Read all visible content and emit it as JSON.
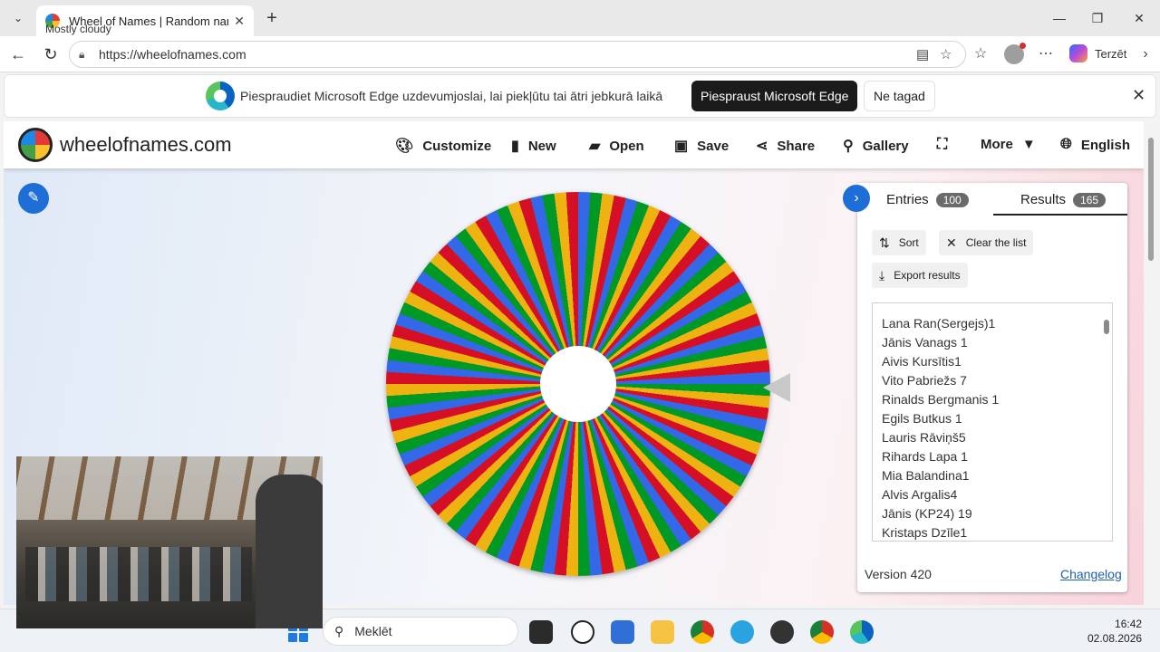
{
  "browser": {
    "tab_title": "Wheel of Names | Random name p",
    "url": "https://wheelofnames.com",
    "profile_label": "Terzēt"
  },
  "infobar": {
    "message": "Piespraudiet Microsoft Edge uzdevumjoslai, lai piekļūtu tai ātri jebkurā laikā",
    "pin_button": "Piespraust Microsoft Edge",
    "not_now_button": "Ne tagad"
  },
  "site": {
    "name": "wheelofnames.com",
    "menu": {
      "customize": "Customize",
      "new": "New",
      "open": "Open",
      "save": "Save",
      "share": "Share",
      "gallery": "Gallery",
      "more": "More",
      "language": "English"
    }
  },
  "panel": {
    "entries_label": "Entries",
    "entries_count": "100",
    "results_label": "Results",
    "results_count": "165",
    "sort": "Sort",
    "clear": "Clear the list",
    "export": "Export results",
    "results": [
      "Lana Ran(Sergejs)1",
      "Jānis Vanags 1",
      "Aivis Kursītis1",
      "Vito Pabriežs 7",
      "Rinalds Bergmanis 1",
      "Egils Butkus 1",
      "Lauris Rāviņš5",
      "Rihards Lapa 1",
      "Mia Balandina1",
      "Alvis Argalis4",
      "Jānis (KP24) 19",
      "Kristaps Dzīle1"
    ],
    "version": "Version 420",
    "changelog": "Changelog"
  },
  "wheel": {
    "colors": [
      "#3369e8",
      "#009925",
      "#eeb211",
      "#d50f25"
    ],
    "segments": 100
  },
  "taskbar": {
    "weather": "Mostly cloudy",
    "search_placeholder": "Meklēt",
    "time": "16:42",
    "date": "02.08.2026"
  }
}
